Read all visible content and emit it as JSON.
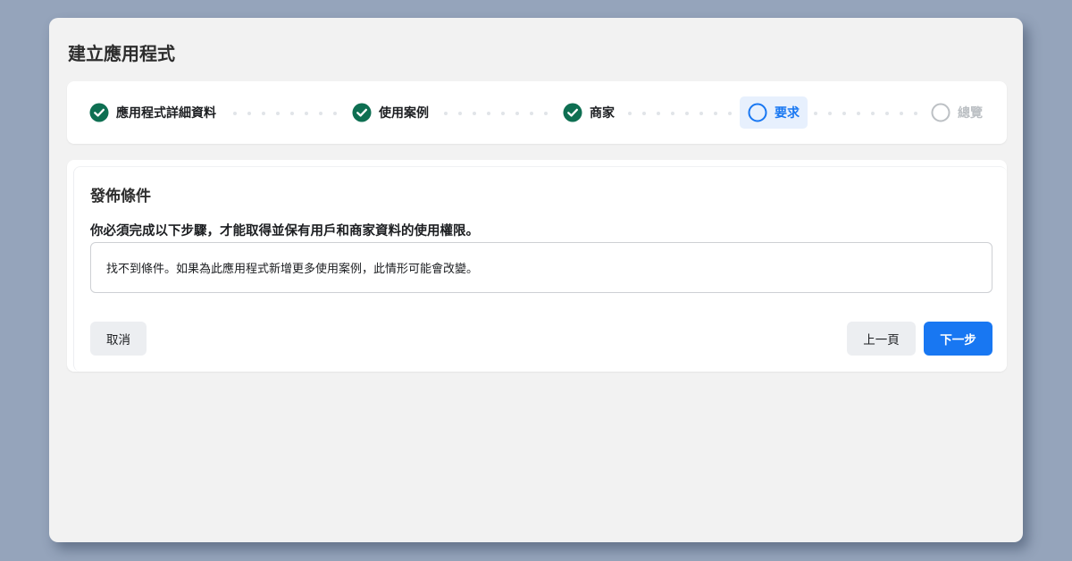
{
  "dialog": {
    "title": "建立應用程式"
  },
  "stepper": {
    "steps": [
      {
        "label": "應用程式詳細資料",
        "state": "completed"
      },
      {
        "label": "使用案例",
        "state": "completed"
      },
      {
        "label": "商家",
        "state": "completed"
      },
      {
        "label": "要求",
        "state": "current"
      },
      {
        "label": "總覽",
        "state": "upcoming"
      }
    ]
  },
  "requirements": {
    "title": "發佈條件",
    "description": "你必須完成以下步驟，才能取得並保有用戶和商家資料的使用權限。",
    "notice": "找不到條件。如果為此應用程式新增更多使用案例，此情形可能會改變。"
  },
  "footer": {
    "cancel_label": "取消",
    "previous_label": "上一頁",
    "next_label": "下一步"
  },
  "colors": {
    "completed": "#0e6f52",
    "current": "#1877f2",
    "upcoming": "#bcc0c4",
    "primary_button": "#1877f2"
  }
}
